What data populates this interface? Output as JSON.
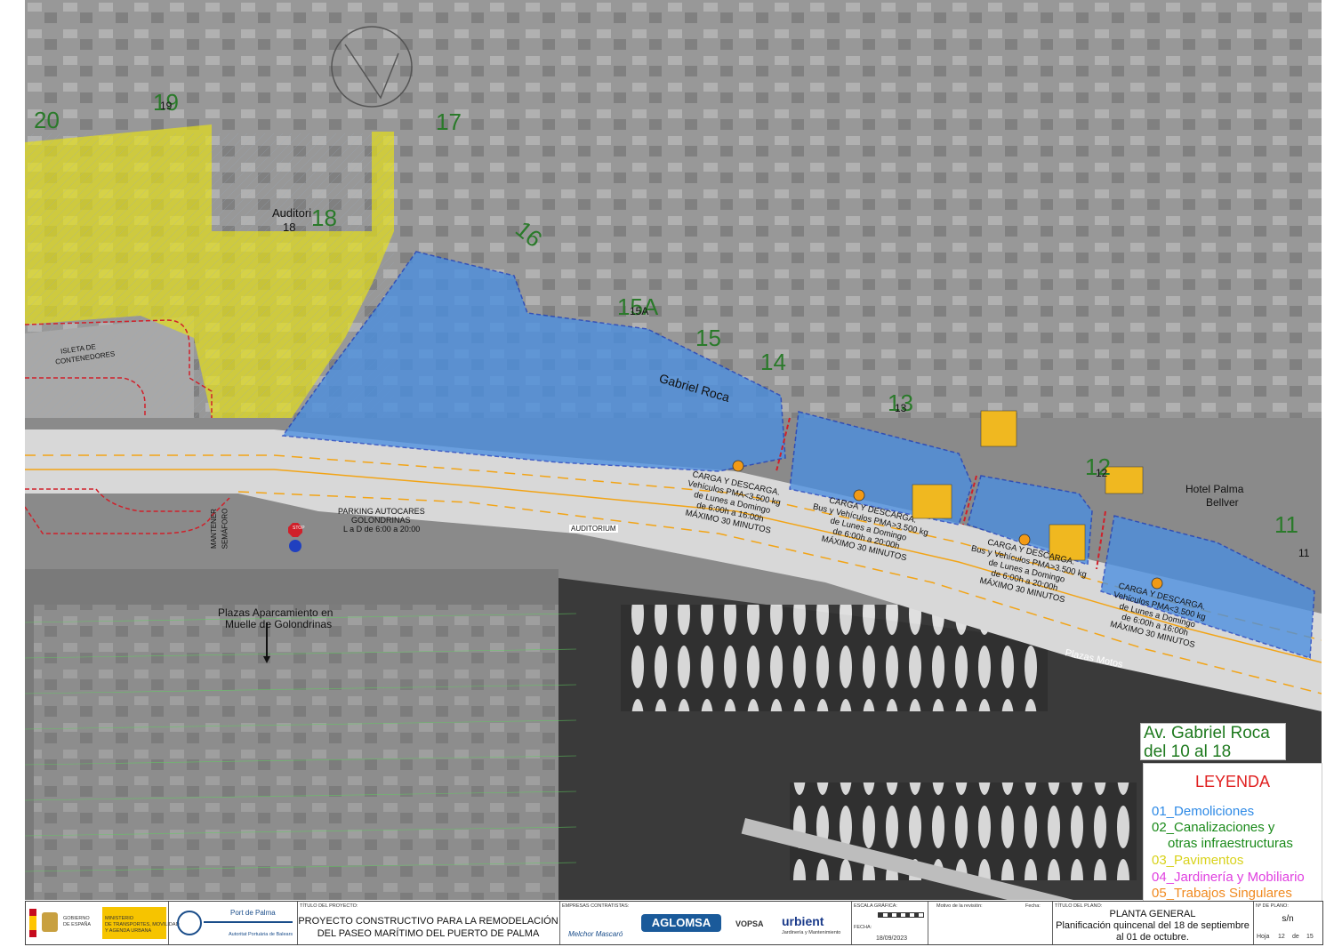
{
  "map": {
    "block_numbers": [
      "20",
      "19",
      "17",
      "16",
      "15A",
      "15",
      "14",
      "13",
      "12",
      "11",
      "18"
    ],
    "block_numbers_small": [
      "19",
      "18",
      "15A",
      "13",
      "12",
      "11"
    ],
    "labels": {
      "auditori": "Auditori",
      "auditori_num": "18",
      "gabriel_roca": "Gabriel Roca",
      "isla_contenedores_1": "ISLETA DE",
      "isla_contenedores_2": "CONTENEDORES",
      "semaforo_1": "SEMÁFORO",
      "semaforo_2": "MANTENER",
      "parking_1": "PARKING AUTOCARES",
      "parking_2": "GOLONDRINAS",
      "parking_3": "L a D de 6:00 a 20:00",
      "auditorium_sign": "AUDITORIUM",
      "hotel_1": "Hotel Palma",
      "hotel_2": "Bellver",
      "plazas_1": "Plazas Aparcamiento en",
      "plazas_2": "Muelle de Golondrinas",
      "plazas_motos": "Plazas Motos",
      "stop": "STOP"
    },
    "loading_notes": [
      [
        "CARGA Y DESCARGA.",
        "Vehículos PMA<3.500 kg",
        "de Lunes a Domingo",
        "de 6:00h a 16:00h",
        "MÁXIMO 30 MINUTOS"
      ],
      [
        "CARGA Y DESCARGA.",
        "Bus y Vehículos PMA>3.500 kg",
        "de Lunes a Domingo",
        "de 6:00h a 20:00h",
        "MÁXIMO 30 MINUTOS"
      ],
      [
        "CARGA Y DESCARGA.",
        "Bus y Vehículos PMA>3.500 kg",
        "de Lunes a Domingo",
        "de 6:00h a 20:00h",
        "MÁXIMO 30 MINUTOS"
      ],
      [
        "CARGA Y DESCARGA.",
        "Vehículos PMA<3.500 kg",
        "de Lunes a Domingo",
        "de 6:00h a 16:00h",
        "MÁXIMO 30 MINUTOS"
      ]
    ],
    "colors": {
      "demoliciones": "#4a8fe0",
      "pavimentos": "#e6e01a",
      "road": "#d6d6d6",
      "water": "#3a3a3a",
      "dashed_red": "#d0202a",
      "dashed_blue": "#1a3fc0",
      "orange_lane": "#f2a416"
    }
  },
  "street_box": {
    "line1": "Av. Gabriel Roca",
    "line2": "del 10 al 18"
  },
  "legend": {
    "title": "LEYENDA",
    "items": [
      {
        "label": "01_Demoliciones",
        "color": "#2e8ae6"
      },
      {
        "label": "02_Canalizaciones y",
        "color": "#1a8a1a"
      },
      {
        "label": "otras infraestructuras",
        "color": "#1a8a1a"
      },
      {
        "label": "03_Pavimentos",
        "color": "#d8d21a"
      },
      {
        "label": "04_Jardinería y Mobiliario",
        "color": "#e040e0"
      },
      {
        "label": "05_Trabajos Singulares",
        "color": "#f08a20"
      }
    ]
  },
  "titleblock": {
    "gob_1": "GOBIERNO",
    "gob_2": "DE ESPAÑA",
    "min_1": "MINISTERIO",
    "min_2": "DE TRANSPORTES, MOVILIDAD",
    "min_3": "Y AGENDA URBANA",
    "port": "Port de Palma",
    "port_sub": "Autoritat Portuària de Balears",
    "titulo_label": "TÍTULO DEL PROYECTO:",
    "titulo_1": "PROYECTO CONSTRUCTIVO PARA LA REMODELACIÓN",
    "titulo_2": "DEL PASEO MARÍTIMO DEL PUERTO DE PALMA",
    "empresas_label": "EMPRESAS CONTRATISTAS:",
    "empresa_1": "Melchor Mascaró",
    "empresa_2": "AGLOMSA",
    "empresa_3": "VOPSA",
    "empresa_4": "urbient",
    "empresa_4_sub": "Jardinería y Mantenimiento",
    "escala_label": "ESCALA GRÁFICA:",
    "fecha_label": "FECHA:",
    "fecha": "18/09/2023",
    "motivo_label": "Motivo de la revisión:",
    "fecha_col": "Fecha:",
    "plano_label": "TÍTULO DEL PLANO:",
    "plano_1": "PLANTA GENERAL",
    "plano_2": "Planificación quincenal del 18 de septiembre",
    "plano_3": "al 01 de octubre.",
    "nplano_label": "Nº DE PLANO:",
    "nplano": "s/n",
    "hoja_label": "Hoja",
    "hoja": "12",
    "de_label": "de",
    "total": "15"
  }
}
